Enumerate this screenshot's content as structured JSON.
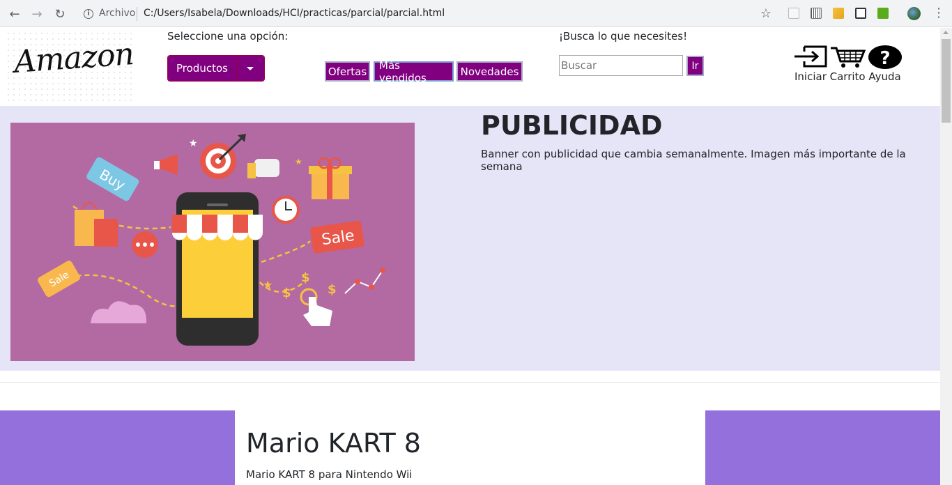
{
  "browser": {
    "security_label": "Archivo",
    "url": "C:/Users/Isabela/Downloads/HCI/practicas/parcial/parcial.html"
  },
  "header": {
    "logo_text": "Amazon",
    "select_label": "Seleccione una opción:",
    "productos_label": "Productos",
    "nav": [
      {
        "label": "Ofertas"
      },
      {
        "label": "Más vendidos"
      },
      {
        "label": "Novedades"
      }
    ],
    "search_label": "¡Busca lo que necesites!",
    "search_placeholder": "Buscar",
    "search_value": "",
    "search_button": "Ir",
    "icon_labels": "Iniciar Carrito Ayuda",
    "icons": [
      "login-icon",
      "cart-icon",
      "help-icon"
    ]
  },
  "banner": {
    "title": "PUBLICIDAD",
    "description": "Banner con publicidad que cambia semanalmente. Imagen más importante de la semana",
    "image_tags": [
      "Buy",
      "Sale",
      "Sale"
    ]
  },
  "product": {
    "title": "Mario KART 8",
    "description": "Mario KART 8 para Nintendo Wii"
  },
  "colors": {
    "primary": "#800080",
    "banner_bg": "#e5e5f7",
    "side_bg": "#9370db",
    "ad_bg": "#b36aa2"
  }
}
